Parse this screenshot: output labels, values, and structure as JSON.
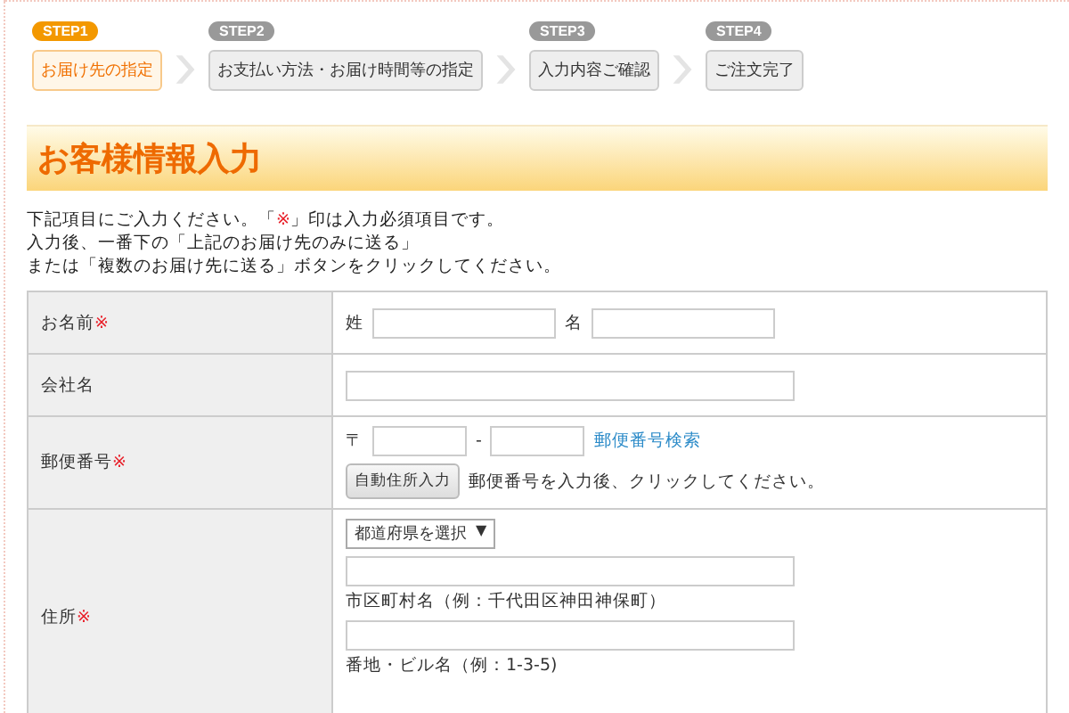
{
  "steps": [
    {
      "step": "STEP1",
      "label": "お届け先の指定",
      "selected": true
    },
    {
      "step": "STEP2",
      "label": "お支払い方法・お届け時間等の指定",
      "selected": false
    },
    {
      "step": "STEP3",
      "label": "入力内容ご確認",
      "selected": false
    },
    {
      "step": "STEP4",
      "label": "ご注文完了",
      "selected": false
    }
  ],
  "heading": "お客様情報入力",
  "instructions": [
    [
      {
        "kind": "plain",
        "text": "下記項目にご入力ください。「"
      },
      {
        "kind": "required",
        "text": "※"
      },
      {
        "kind": "plain",
        "text": "」印は入力必須項目です。"
      }
    ],
    [
      {
        "kind": "plain",
        "text": "入力後、一番下の「上記のお届け先のみに送る」"
      }
    ],
    [
      {
        "kind": "plain",
        "text": "または「複数のお届け先に送る」ボタンをクリックしてください。"
      }
    ]
  ],
  "form": {
    "rows": [
      {
        "kind": "name",
        "label": "お名前",
        "required_mark": "※",
        "last_name_label": "姓",
        "first_name_label": "名"
      },
      {
        "kind": "company",
        "label": "会社名"
      },
      {
        "kind": "postal",
        "label": "郵便番号",
        "required_mark": "※",
        "prefix": "〒",
        "separator": "-",
        "search_link": "郵便番号検索",
        "auto_button": "自動住所入力",
        "auto_note": "郵便番号を入力後、クリックしてください。"
      },
      {
        "kind": "address",
        "label": "住所",
        "required_mark": "※",
        "prefecture_select": "都道府県を選択",
        "select_arrow": "▼",
        "city_hint": "市区町村名（例：千代田区神田神保町）",
        "street_hint": "番地・ビル名（例：1-3-5)"
      }
    ]
  }
}
